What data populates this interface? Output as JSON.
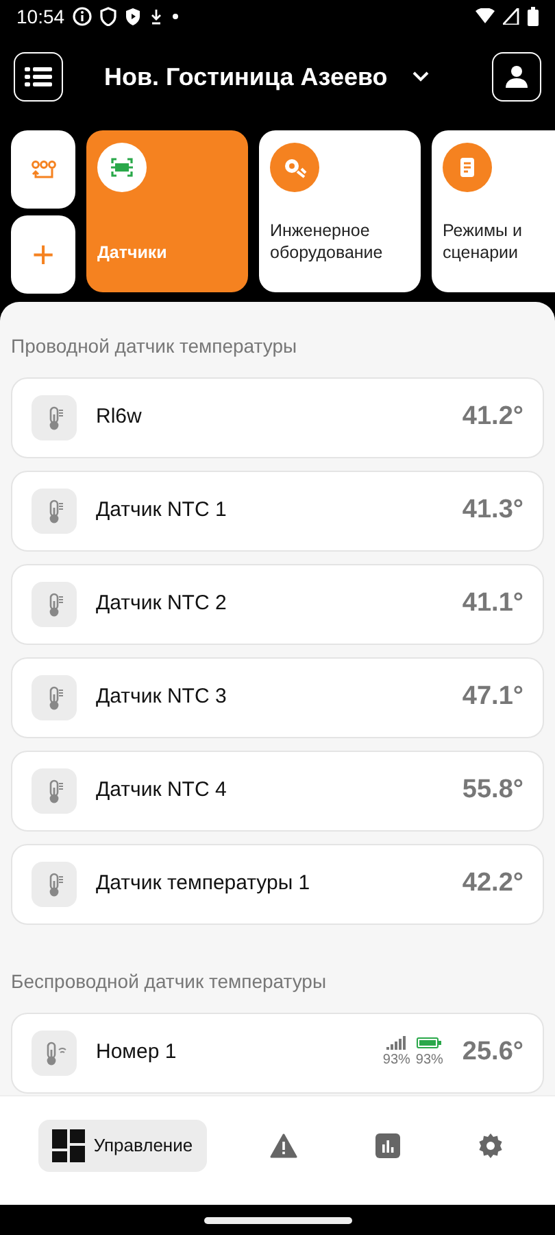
{
  "status_bar": {
    "time": "10:54"
  },
  "header": {
    "title": "Нов. Гостиница Азеево"
  },
  "side_tiles": [
    {
      "kind": "scenes"
    },
    {
      "kind": "add",
      "label": "+"
    }
  ],
  "tiles": [
    {
      "kind": "sensors",
      "label": "Датчики",
      "selected": true
    },
    {
      "kind": "engineering",
      "label": "Инженерное оборудование",
      "selected": false
    },
    {
      "kind": "modes",
      "label": "Режимы и сценарии",
      "selected": false
    }
  ],
  "sections": [
    {
      "title": "Проводной датчик температуры",
      "sensors": [
        {
          "kind": "wired",
          "name": "Rl6w",
          "value": "41.2°"
        },
        {
          "kind": "wired",
          "name": "Датчик NTC 1",
          "value": "41.3°"
        },
        {
          "kind": "wired",
          "name": "Датчик NTC 2",
          "value": "41.1°"
        },
        {
          "kind": "wired",
          "name": "Датчик NTC 3",
          "value": "47.1°"
        },
        {
          "kind": "wired",
          "name": "Датчик NTC 4",
          "value": "55.8°"
        },
        {
          "kind": "wired",
          "name": "Датчик температуры 1",
          "value": "42.2°"
        }
      ]
    },
    {
      "title": "Беспроводной датчик температуры",
      "sensors": [
        {
          "kind": "wireless",
          "name": "Номер 1",
          "value": "25.6°",
          "signal": "93%",
          "battery": "93%"
        }
      ]
    }
  ],
  "bottom_nav": [
    {
      "kind": "control",
      "label": "Управление",
      "selected": true
    },
    {
      "kind": "alerts",
      "selected": false
    },
    {
      "kind": "stats",
      "selected": false
    },
    {
      "kind": "settings",
      "selected": false
    }
  ]
}
